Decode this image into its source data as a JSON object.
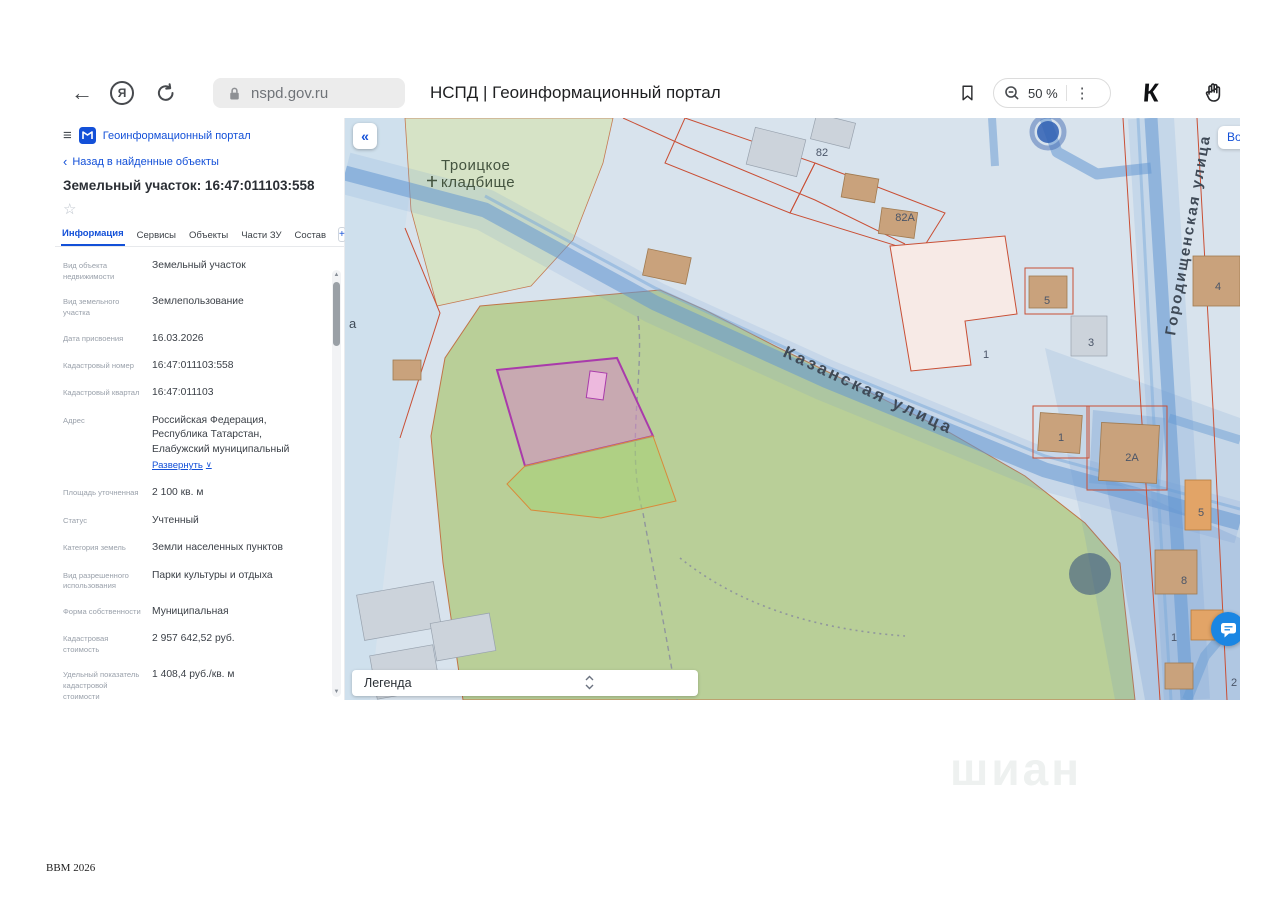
{
  "browser": {
    "url": "nspd.gov.ru",
    "page_title": "НСПД | Геоинформационный портал",
    "zoom_level": "50 %"
  },
  "icons": {
    "back_arrow": "←",
    "yandex_letter": "Я",
    "menu_dots": "⋮",
    "k_logo": "К",
    "hamburger": "≡",
    "chevron_left": "‹",
    "star": "☆",
    "plus": "+",
    "expand_chevron": "∨",
    "scroll_up": "▲",
    "scroll_down": "▼",
    "collapse_left": "«"
  },
  "sidebar": {
    "portal_title": "Геоинформационный портал",
    "back_link": "Назад в найденные объекты",
    "object_title": "Земельный участок: 16:47:011103:558",
    "tabs": [
      {
        "label": "Информация"
      },
      {
        "label": "Сервисы"
      },
      {
        "label": "Объекты"
      },
      {
        "label": "Части ЗУ"
      },
      {
        "label": "Состав"
      }
    ],
    "fields": [
      {
        "label": "Вид объекта недвижимости",
        "value": "Земельный участок"
      },
      {
        "label": "Вид земельного участка",
        "value": "Землепользование"
      },
      {
        "label": "Дата присвоения",
        "value": "16.03.2026"
      },
      {
        "label": "Кадастровый номер",
        "value": "16:47:011103:558"
      },
      {
        "label": "Кадастровый квартал",
        "value": "16:47:011103"
      },
      {
        "label": "Адрес",
        "value": "Российская Федерация, Республика Татарстан, Елабужский муниципальный",
        "expand_label": "Развернуть"
      },
      {
        "label": "Площадь уточненная",
        "value": "2 100 кв. м"
      },
      {
        "label": "Статус",
        "value": "Учтенный"
      },
      {
        "label": "Категория земель",
        "value": "Земли населенных пунктов"
      },
      {
        "label": "Вид разрешенного использования",
        "value": "Парки культуры и отдыха"
      },
      {
        "label": "Форма собственности",
        "value": "Муниципальная"
      },
      {
        "label": "Кадастровая стоимость",
        "value": "2 957 642,52 руб."
      },
      {
        "label": "Удельный показатель кадастровой стоимости",
        "value": "1 408,4 руб./кв. м"
      }
    ]
  },
  "map": {
    "login_label": "Войти",
    "legend_label": "Легенда",
    "cemetery_line1": "Троицкое",
    "cemetery_line2": "кладбище",
    "street_kazanskaya": "Казанская  улица",
    "street_gorodishchenskaya": "Городищенская  улица",
    "edge_label": "а",
    "house_numbers": [
      "82",
      "82А",
      "5",
      "4",
      "1",
      "3",
      "1",
      "2А",
      "5",
      "8",
      "1",
      "2"
    ],
    "colors": {
      "selected_parcel_stroke": "#a93bab",
      "park_fill": "#b6cc8e",
      "road_blue": "#6498d2",
      "cadastral_red": "#c94f35"
    }
  },
  "footer": {
    "watermark_left": "BBM 2026",
    "watermark_right": "шиан"
  }
}
